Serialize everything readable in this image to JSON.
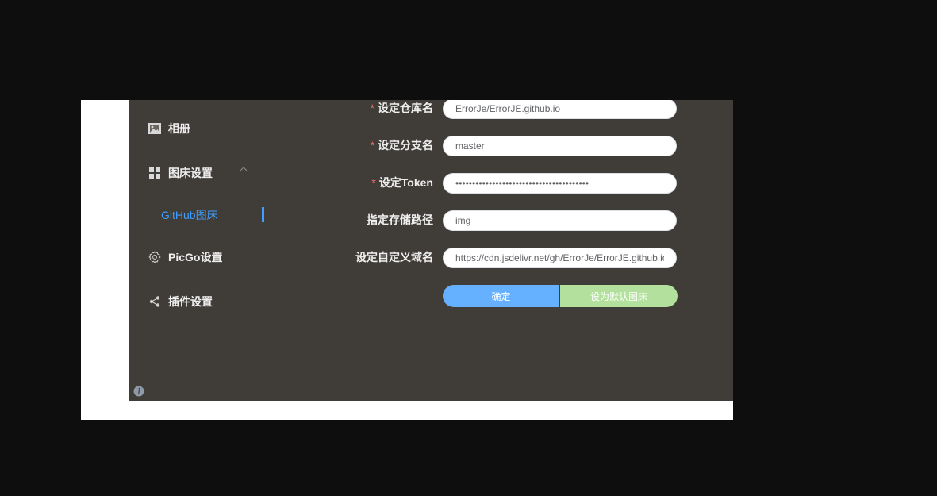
{
  "sidebar": {
    "items": [
      {
        "label": "相册",
        "icon": "image-icon"
      },
      {
        "label": "图床设置",
        "icon": "grid-icon"
      },
      {
        "label": "GitHub图床"
      },
      {
        "label": "PicGo设置",
        "icon": "gear-icon"
      },
      {
        "label": "插件设置",
        "icon": "share-icon"
      }
    ]
  },
  "form": {
    "repo": {
      "label": "设定仓库名",
      "required": true,
      "value": "ErrorJe/ErrorJE.github.io"
    },
    "branch": {
      "label": "设定分支名",
      "required": true,
      "value": "master"
    },
    "token": {
      "label": "设定Token",
      "required": true,
      "value": "••••••••••••••••••••••••••••••••••••••••"
    },
    "path": {
      "label": "指定存储路径",
      "required": false,
      "value": "img"
    },
    "domain": {
      "label": "设定自定义域名",
      "required": false,
      "value": "https://cdn.jsdelivr.net/gh/ErrorJe/ErrorJE.github.io"
    },
    "required_mark": "*",
    "confirm_label": "确定",
    "default_label": "设为默认图床"
  },
  "colors": {
    "panel_bg": "#403c37",
    "accent": "#409eff",
    "required": "#f56c6c",
    "confirm_button": "#66b1ff",
    "default_button": "#b3e19d"
  }
}
